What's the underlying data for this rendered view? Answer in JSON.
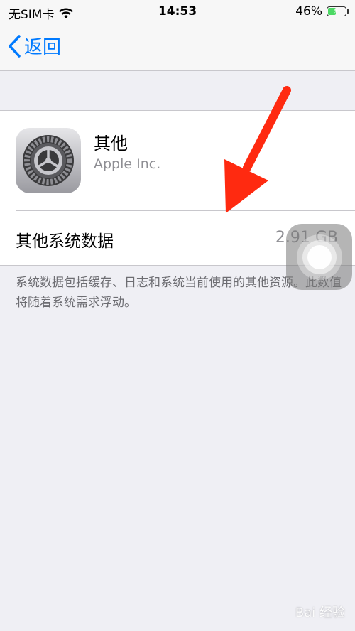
{
  "status_bar": {
    "carrier": "无SIM卡",
    "time": "14:53",
    "battery_percent": "46%",
    "battery_level": 0.46
  },
  "nav": {
    "back_label": "返回"
  },
  "app": {
    "name": "其他",
    "vendor": "Apple Inc."
  },
  "storage_row": {
    "label": "其他系统数据",
    "value": "2.91 GB"
  },
  "footnote": "系统数据包括缓存、日志和系统当前使用的其他资源。此数值将随着系统需求浮动。",
  "watermark": "Bai 经验",
  "colors": {
    "accent": "#007aff",
    "annotation_arrow": "#ff2a10",
    "battery_green": "#4cd964"
  }
}
